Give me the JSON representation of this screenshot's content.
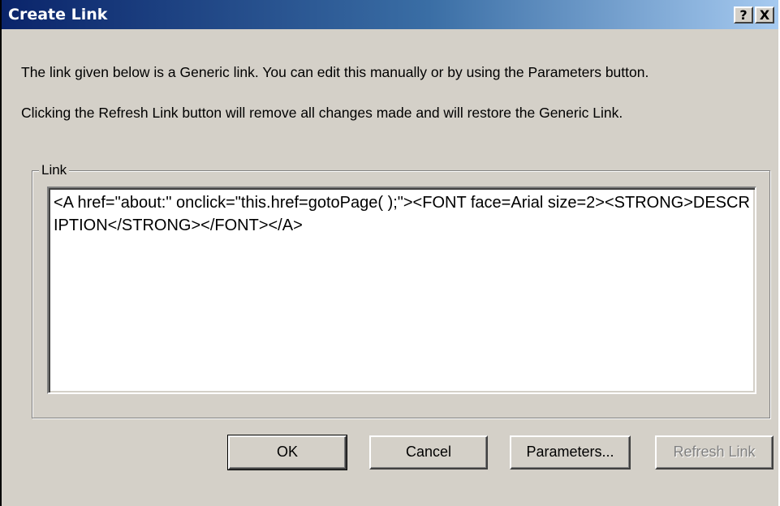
{
  "window": {
    "title": "Create Link",
    "help_button": "?",
    "close_button": "X"
  },
  "info": {
    "line1": "The link given below is a Generic link. You can edit this manually or by using the Parameters button.",
    "line2": "Clicking the Refresh Link button will remove all changes made and will restore the Generic Link."
  },
  "link_group": {
    "legend": "Link",
    "value": "<A href=\"about:\" onclick=\"this.href=gotoPage( );\"><FONT face=Arial size=2><STRONG>DESCRIPTION</STRONG></FONT></A>"
  },
  "buttons": {
    "ok": "OK",
    "cancel": "Cancel",
    "parameters": "Parameters...",
    "refresh": "Refresh Link"
  },
  "colors": {
    "title_gradient_start": "#0a246a",
    "title_gradient_end": "#a6caf0",
    "dialog_face": "#d4d0c8",
    "disabled_text": "#808080"
  }
}
